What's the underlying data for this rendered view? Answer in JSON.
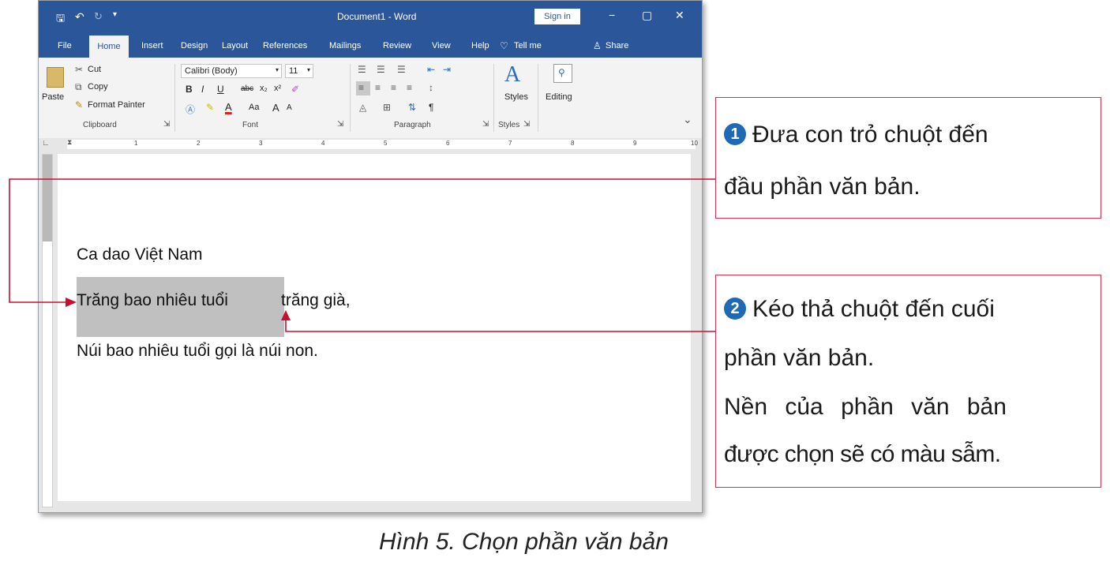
{
  "window": {
    "title": "Document1 - Word",
    "signin": "Sign in",
    "controls": [
      "−",
      "▢",
      "✕"
    ]
  },
  "tabs": [
    "File",
    "Home",
    "Insert",
    "Design",
    "Layout",
    "References",
    "Mailings",
    "Review",
    "View",
    "Help",
    "Tell me",
    "Share"
  ],
  "ribbon": {
    "clipboard": {
      "paste": "Paste",
      "cut": "Cut",
      "copy": "Copy",
      "format_painter": "Format Painter",
      "label": "Clipboard"
    },
    "font": {
      "name": "Calibri (Body)",
      "size": "11",
      "label": "Font",
      "bold": "B",
      "italic": "I",
      "underline": "U",
      "strike": "abc",
      "sub": "x₂",
      "sup": "x²",
      "case": "Aa",
      "grow": "A",
      "shrink": "A"
    },
    "paragraph": {
      "label": "Paragraph",
      "pilcrow": "¶"
    },
    "styles": {
      "label": "Styles",
      "button": "Styles"
    },
    "editing": {
      "button": "Editing"
    }
  },
  "ruler_numbers": [
    "1",
    "2",
    "3",
    "4",
    "5",
    "6",
    "7",
    "8",
    "9",
    "10"
  ],
  "document": {
    "line1": "Ca dao Việt Nam",
    "line2_selected": "Trăng bao nhiêu tuổi",
    "line2_rest": " trăng già,",
    "line3": "Núi bao nhiêu tuổi gọi là núi non."
  },
  "callouts": {
    "step1_num": "1",
    "step1_line1": "Đưa con trỏ chuột đến",
    "step1_line2": "đầu phần văn bản.",
    "step2_num": "2",
    "step2_line1": "Kéo thả chuột đến cuối",
    "step2_line2": "phần văn bản.",
    "step2_line3": "Nền của phần văn bản",
    "step2_line4": "được chọn sẽ có màu sẫm."
  },
  "caption": "Hình 5. Chọn phần văn bản",
  "colors": {
    "word_blue": "#2b579a",
    "selection": "#c0c0c0",
    "callout_border": "#d6304a",
    "arrow": "#c8102e",
    "step_badge": "#1e6ab4"
  }
}
